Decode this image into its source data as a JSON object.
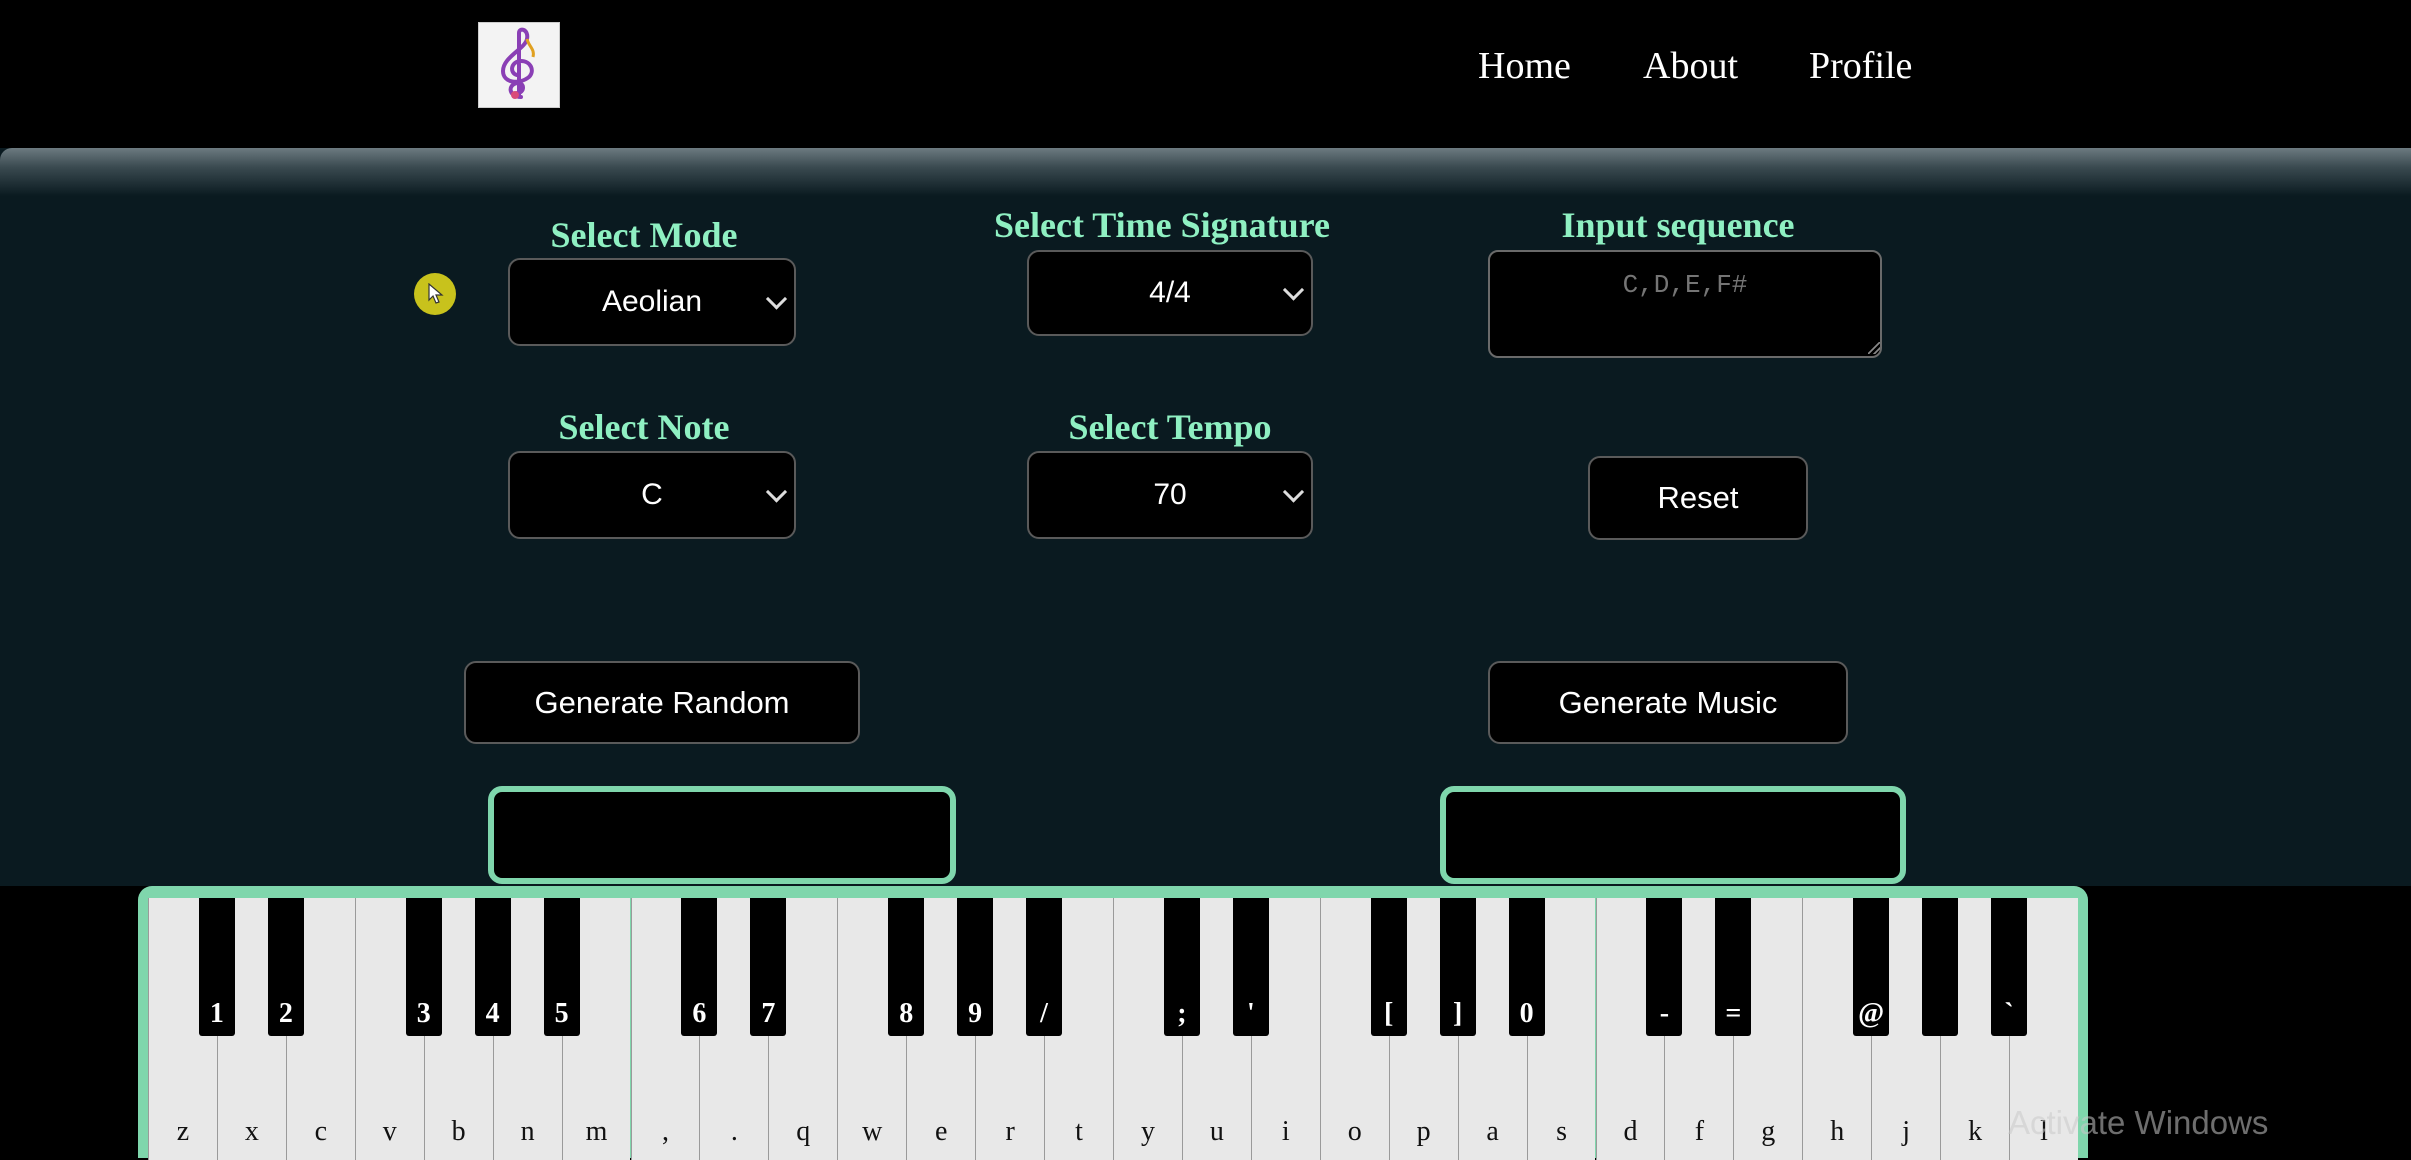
{
  "nav": {
    "items": [
      {
        "label": "Home"
      },
      {
        "label": "About"
      },
      {
        "label": "Profile"
      }
    ]
  },
  "controls": {
    "mode": {
      "label": "Select Mode",
      "value": "Aeolian"
    },
    "time_signature": {
      "label": "Select Time Signature",
      "value": "4/4"
    },
    "sequence": {
      "label": "Input sequence",
      "placeholder": "C,D,E,F#"
    },
    "note": {
      "label": "Select Note",
      "value": "C"
    },
    "tempo": {
      "label": "Select Tempo",
      "value": "70"
    },
    "reset_label": "Reset",
    "generate_random_label": "Generate Random",
    "generate_music_label": "Generate Music"
  },
  "piano": {
    "white_keys": [
      "z",
      "x",
      "c",
      "v",
      "b",
      "n",
      "m",
      ",",
      ".",
      "q",
      "w",
      "e",
      "r",
      "t",
      "y",
      "u",
      "i",
      "o",
      "p",
      "a",
      "s",
      "d",
      "f",
      "g",
      "h",
      "j",
      "k",
      "l"
    ],
    "black_keys": [
      {
        "label": "1",
        "after": 0
      },
      {
        "label": "2",
        "after": 1
      },
      {
        "label": "3",
        "after": 3
      },
      {
        "label": "4",
        "after": 4
      },
      {
        "label": "5",
        "after": 5
      },
      {
        "label": "6",
        "after": 7
      },
      {
        "label": "7",
        "after": 8
      },
      {
        "label": "8",
        "after": 10
      },
      {
        "label": "9",
        "after": 11
      },
      {
        "label": "/",
        "after": 12
      },
      {
        "label": ";",
        "after": 14
      },
      {
        "label": "'",
        "after": 15
      },
      {
        "label": "[",
        "after": 17
      },
      {
        "label": "]",
        "after": 18
      },
      {
        "label": "0",
        "after": 19
      },
      {
        "label": "-",
        "after": 21
      },
      {
        "label": "=",
        "after": 22
      },
      {
        "label": "@",
        "after": 24
      },
      {
        "label": "",
        "after": 25
      },
      {
        "label": "`",
        "after": 26
      }
    ]
  },
  "watermark": "Activate Windows",
  "colors": {
    "accent": "#8ff0c2",
    "panel": "#0a1a20",
    "piano_border": "#7fd6ac"
  }
}
